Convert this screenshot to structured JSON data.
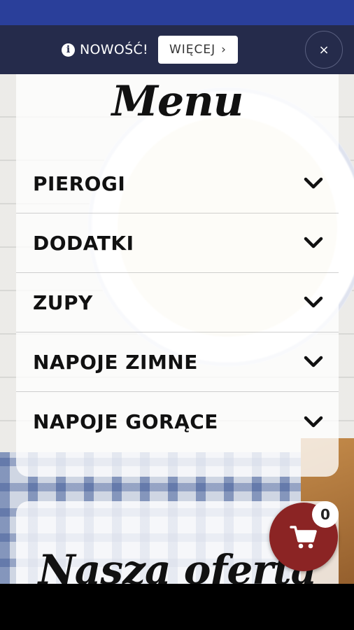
{
  "notice": {
    "text": "NOWOŚĆ!",
    "more_label": "WIĘCEJ",
    "more_chevron": "›",
    "close_label": "×"
  },
  "menu": {
    "title": "Menu",
    "items": [
      {
        "label": "PIEROGI"
      },
      {
        "label": "DODATKI"
      },
      {
        "label": "ZUPY"
      },
      {
        "label": "NAPOJE ZIMNE"
      },
      {
        "label": "NAPOJE GORĄCE"
      }
    ]
  },
  "offer": {
    "title": "Nasza oferta"
  },
  "cart": {
    "count": "0"
  },
  "colors": {
    "status_bar": "#2a3f9a",
    "notice_bar": "#252b4b",
    "cart_button": "#8b2424"
  },
  "icons": {
    "info": "info-icon",
    "chevron": "chevron-down-icon",
    "cart": "shopping-cart-icon",
    "close": "close-icon"
  }
}
